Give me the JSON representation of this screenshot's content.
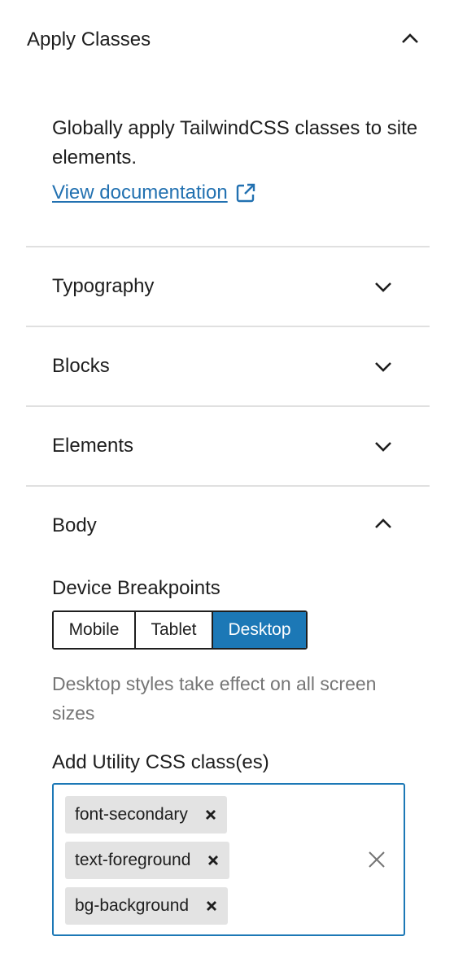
{
  "panel": {
    "title": "Apply Classes",
    "description": "Globally apply TailwindCSS classes to site elements.",
    "doc_link": "View documentation",
    "link_color": "#2271b1"
  },
  "sections": {
    "typography": "Typography",
    "blocks": "Blocks",
    "elements": "Elements",
    "body": "Body"
  },
  "body_section": {
    "breakpoints_label": "Device Breakpoints",
    "breakpoints": [
      "Mobile",
      "Tablet",
      "Desktop"
    ],
    "selected_breakpoint": "Desktop",
    "help_text": "Desktop styles take effect on all screen sizes",
    "classes_label": "Add Utility CSS class(es)",
    "tokens": [
      "font-secondary",
      "text-foreground",
      "bg-background"
    ],
    "accent_color": "#1c78b6"
  },
  "icons": {
    "collapse": "chevron-up-icon",
    "expand": "chevron-down-icon",
    "external": "external-link-icon",
    "remove": "close-icon"
  }
}
